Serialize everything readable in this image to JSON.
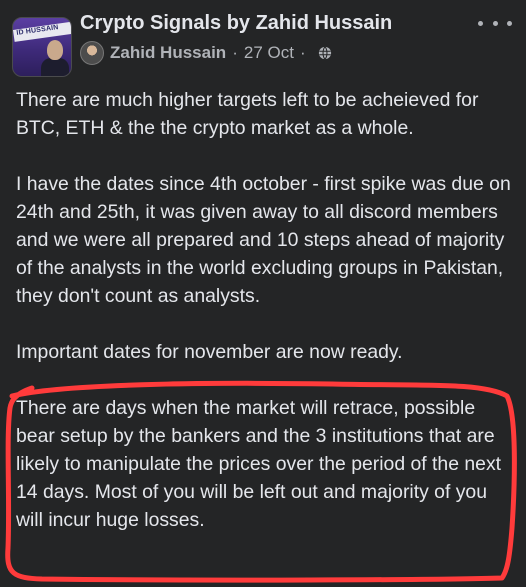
{
  "post": {
    "group_name": "Crypto Signals by Zahid Hussain",
    "group_avatar_text": "ID HUSSAIN",
    "author": "Zahid Hussain",
    "separator": "·",
    "date": "27 Oct",
    "privacy_icon": "globe-icon",
    "more_icon": "more-horizontal-icon",
    "paragraphs": [
      "There are much higher targets left to be acheieved for BTC, ETH & the the crypto market as a whole.",
      "I have the dates since 4th october - first spike was due on 24th and 25th, it was given away to all discord members and we were all prepared and 10 steps ahead of majority of the analysts in the world excluding groups in Pakistan, they don't count as analysts.",
      "Important dates for november are now ready.",
      "There are days when the market will retrace, possible bear setup by the bankers and the 3 institutions that are likely to manipulate the prices over the period of the next 14 days. Most of you will be left out and majority of you will incur huge losses."
    ]
  },
  "colors": {
    "background": "#242526",
    "primary_text": "#e4e6eb",
    "secondary_text": "#b0b3b8",
    "annotation_red": "#ff3b3b"
  }
}
